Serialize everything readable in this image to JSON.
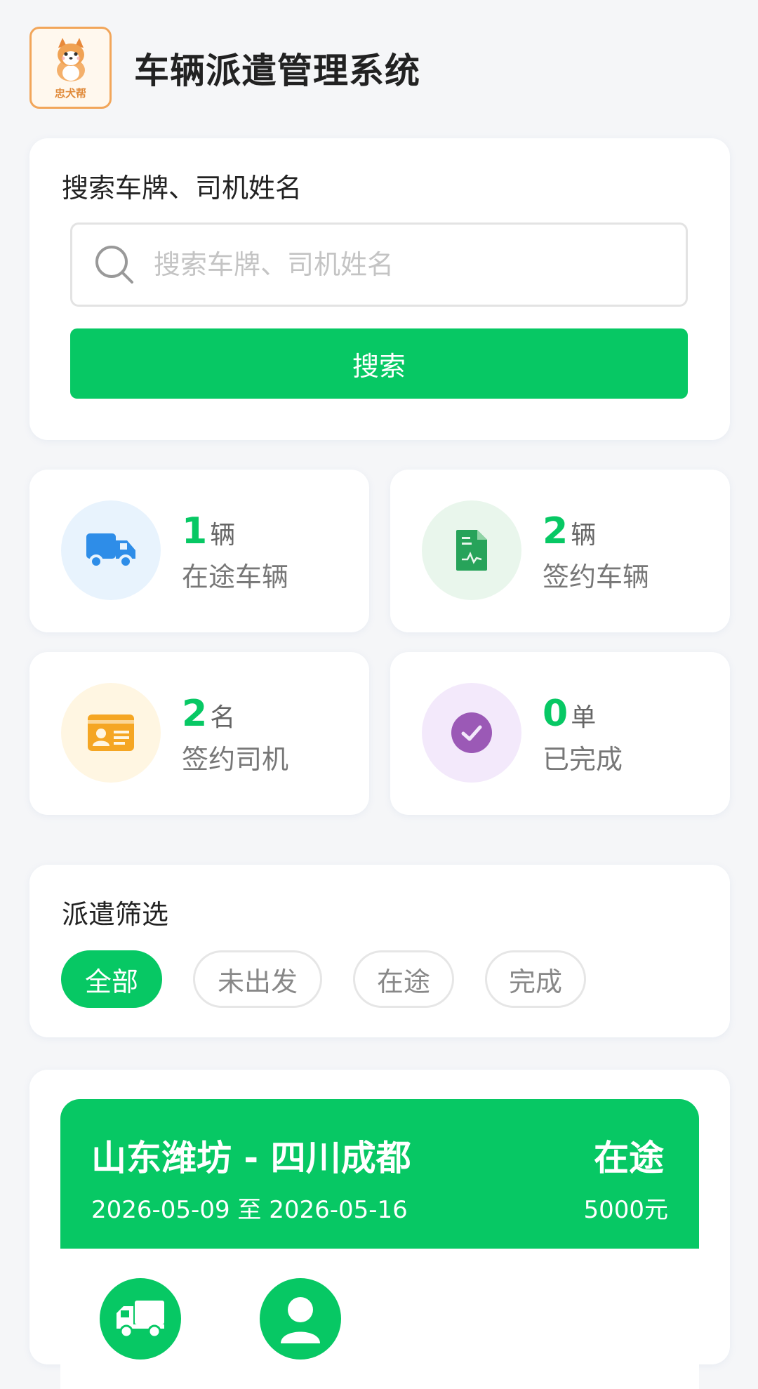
{
  "header": {
    "logo_text": "忠犬帮",
    "title": "车辆派遣管理系统"
  },
  "search": {
    "label": "搜索车牌、司机姓名",
    "placeholder": "搜索车牌、司机姓名",
    "value": "",
    "button_label": "搜索"
  },
  "stats": [
    {
      "number": "1",
      "unit": "辆",
      "label": "在途车辆",
      "icon": "truck-icon",
      "color": "#2e8de8",
      "bg": "#e8f3fd"
    },
    {
      "number": "2",
      "unit": "辆",
      "label": "签约车辆",
      "icon": "contract-icon",
      "color": "#27a35a",
      "bg": "#e9f6ec"
    },
    {
      "number": "2",
      "unit": "名",
      "label": "签约司机",
      "icon": "id-card-icon",
      "color": "#f5a623",
      "bg": "#fff6e2"
    },
    {
      "number": "0",
      "unit": "单",
      "label": "已完成",
      "icon": "check-circle-icon",
      "color": "#9b59b6",
      "bg": "#f3e9fb"
    }
  ],
  "filter": {
    "title": "派遣筛选",
    "chips": [
      "全部",
      "未出发",
      "在途",
      "完成"
    ],
    "active_index": 0
  },
  "dispatches": [
    {
      "route": "山东潍坊 - 四川成都",
      "dates": "2026-05-09 至 2026-05-16",
      "status": "在途",
      "price": "5000元"
    }
  ],
  "colors": {
    "accent": "#07c864",
    "background": "#f5f6f8"
  }
}
